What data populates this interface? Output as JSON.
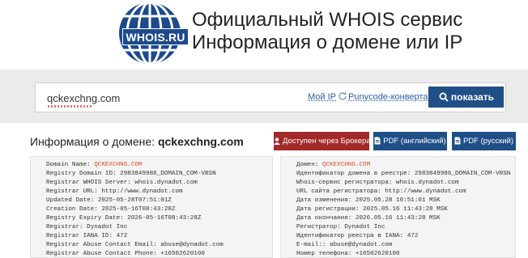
{
  "header": {
    "logo_text": "WHOIS.RU",
    "title_line1": "Официальный WHOIS сервис",
    "title_line2": "Информация о домене или IP"
  },
  "search": {
    "value": "qckexchng.com",
    "my_ip_label": "Мой IP",
    "punycode_label": "Punycode-конвертация",
    "submit_label": "показать"
  },
  "info": {
    "prefix": "Информация о домене:",
    "domain": "qckexchng.com",
    "broker_button": "Доступен через Брокера",
    "pdf_en_button": "PDF (английский)",
    "pdf_ru_button": "PDF (русский)"
  },
  "record_en": [
    {
      "label": "Domain Name: ",
      "value": "QCKEXCHNG.COM",
      "highlight": true
    },
    {
      "label": "Registry Domain ID: ",
      "value": "2983849986_DOMAIN_COM-VRSN"
    },
    {
      "label": "Registrar WHOIS Server: ",
      "value": "whois.dynadot.com"
    },
    {
      "label": "Registrar URL: ",
      "value": "http://www.dynadot.com"
    },
    {
      "label": "Updated Date: ",
      "value": "2025-05-28T07:51:01Z"
    },
    {
      "label": "Creation Date: ",
      "value": "2025-05-16T08:43:28Z"
    },
    {
      "label": "Registry Expiry Date: ",
      "value": "2026-05-16T08:43:28Z"
    },
    {
      "label": "Registrar: ",
      "value": "Dynadot Inc"
    },
    {
      "label": "Registrar IANA ID: ",
      "value": "472"
    },
    {
      "label": "Registrar Abuse Contact Email: ",
      "value": "abuse@dynadot.com"
    },
    {
      "label": "Registrar Abuse Contact Phone: ",
      "value": "+16502620100"
    }
  ],
  "record_ru": [
    {
      "label": "Домен: ",
      "value": "QCKEXCHNG.COM",
      "highlight": true
    },
    {
      "label": "Идентификатор домена в реестре: ",
      "value": "2983849986_DOMAIN_COM-VRSN"
    },
    {
      "label": "Whois-сервис регистратора: ",
      "value": "whois.dynadot.com"
    },
    {
      "label": "URL сайта регистратора: ",
      "value": "http://www.dynadot.com"
    },
    {
      "label": "Дата изменения: ",
      "value": "2025.05.28 10:51:01 MSK"
    },
    {
      "label": "Дата регистрации: ",
      "value": "2025.05.16 11:43:28 MSK"
    },
    {
      "label": "Дата окончания: ",
      "value": "2026.05.16 11:43:28 MSK"
    },
    {
      "label": "Регистратор: ",
      "value": "Dynadot Inc"
    },
    {
      "label": "Идентификатор реестра в IANA: ",
      "value": "472"
    },
    {
      "label": "E-mail:: ",
      "value": "abuse@dynadot.com"
    },
    {
      "label": "Номер телефона: ",
      "value": "+16502620100"
    }
  ],
  "colors": {
    "brand_blue": "#1f4f86",
    "broker_red": "#a32a2a",
    "highlight_orange": "#e04a2a",
    "search_band": "#ebebeb"
  },
  "icons": [
    "globe-logo-icon",
    "refresh-icon",
    "search-icon",
    "user-icon",
    "pdf-icon"
  ]
}
